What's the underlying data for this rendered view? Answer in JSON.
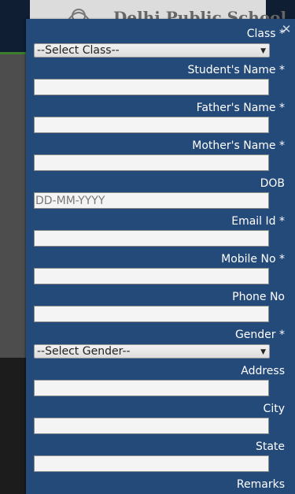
{
  "background": {
    "school_name": "Delhi Public School"
  },
  "modal": {
    "close_icon": "close-icon",
    "fields": {
      "class": {
        "label": "Class *",
        "value": "--Select Class--"
      },
      "student_name": {
        "label": "Student's Name *",
        "value": ""
      },
      "father_name": {
        "label": "Father's Name *",
        "value": ""
      },
      "mother_name": {
        "label": "Mother's Name *",
        "value": ""
      },
      "dob": {
        "label": "DOB",
        "value": "",
        "placeholder": "DD-MM-YYYY"
      },
      "email": {
        "label": "Email Id *",
        "value": ""
      },
      "mobile": {
        "label": "Mobile No *",
        "value": ""
      },
      "phone": {
        "label": "Phone No",
        "value": ""
      },
      "gender": {
        "label": "Gender *",
        "value": "--Select Gender--"
      },
      "address": {
        "label": "Address",
        "value": ""
      },
      "city": {
        "label": "City",
        "value": ""
      },
      "state": {
        "label": "State",
        "value": ""
      },
      "remarks": {
        "label": "Remarks"
      }
    }
  },
  "colors": {
    "modal_bg": "#244a7a",
    "field_bg": "#f4f4f4"
  }
}
